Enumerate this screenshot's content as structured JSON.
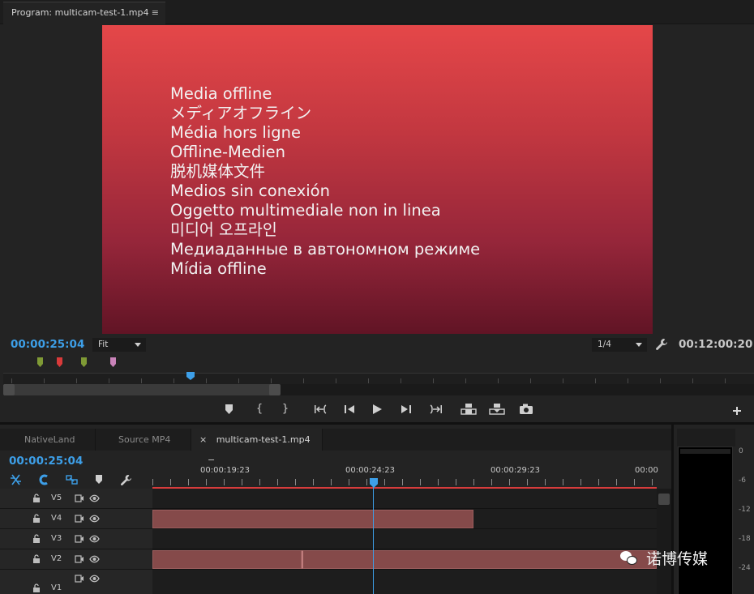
{
  "program_monitor": {
    "tab_title": "Program: multicam-test-1.mp4",
    "menu_icon": "≡",
    "offline_messages": [
      "Media offline",
      "メディアオフライン",
      "Média hors ligne",
      "Offline-Medien",
      "脱机媒体文件",
      "Medios sin conexión",
      "Oggetto multimediale non in linea",
      "미디어 오프라인",
      "Медиаданные в автономном режиме",
      "Mídia offline"
    ],
    "current_timecode": "00:00:25:04",
    "zoom_value": "Fit",
    "resolution_value": "1/4",
    "duration_timecode": "00:12:00:20",
    "marker_colors": [
      "#7f9a35",
      "#d93a3a",
      "#7f9a35",
      "#c983b9"
    ]
  },
  "timeline": {
    "tabs": [
      "NativeLand",
      "Source MP4",
      "multicam-test-1.mp4"
    ],
    "close_glyph": "×",
    "menu_icon": "≡",
    "current_timecode": "00:00:25:04",
    "ruler_labels": [
      "00:00:19:23",
      "00:00:24:23",
      "00:00:29:23",
      "00:00"
    ],
    "tracks": [
      {
        "name": "V5"
      },
      {
        "name": "V4"
      },
      {
        "name": "V3"
      },
      {
        "name": "V2"
      },
      {
        "name": "V1"
      }
    ]
  },
  "audio_meter": {
    "db_labels": [
      "0",
      "-6",
      "-12",
      "-18",
      "-24"
    ]
  },
  "watermark": {
    "text": "诺博传媒"
  },
  "colors": {
    "accent_blue": "#3d9fe8",
    "clip": "#854a4a",
    "work_area_red": "#d63c3c"
  }
}
